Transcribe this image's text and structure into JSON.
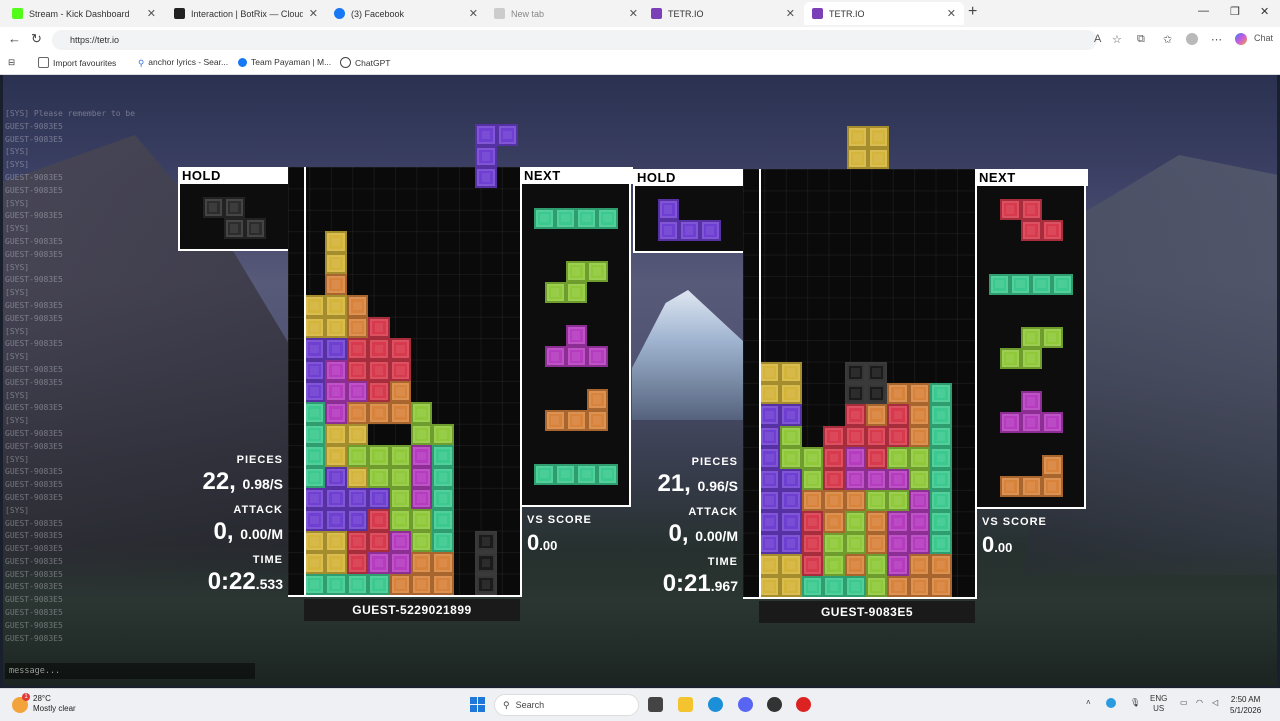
{
  "browser": {
    "tabs": [
      {
        "label": "Stream - Kick Dashboard",
        "fav_color": "#53fc18",
        "active": false
      },
      {
        "label": "Interaction | BotRix — Cloud Stream",
        "fav_color": "#222222",
        "active": false
      },
      {
        "label": "(3) Facebook",
        "fav_color": "#1877f2",
        "active": false
      },
      {
        "label": "New tab",
        "fav_color": "#bbbbbb",
        "active": false
      },
      {
        "label": "TETR.IO",
        "fav_color": "#7b3fb8",
        "active": false
      },
      {
        "label": "TETR.IO",
        "fav_color": "#7b3fb8",
        "active": true
      }
    ],
    "new_tab_label": "+",
    "url": "https://tetr.io",
    "bookmarks": [
      "Import favourites",
      "anchor lyrics - Sear...",
      "Team Payaman | M...",
      "ChatGPT"
    ],
    "copilot_label": "Chat"
  },
  "chat": {
    "lines": [
      "[SYS] Please remember to be",
      "GUEST-9083E5",
      "GUEST-9083E5",
      "[SYS]",
      "[SYS]",
      "GUEST-9083E5",
      "GUEST-9083E5",
      "[SYS]",
      "GUEST-9083E5",
      "[SYS]",
      "GUEST-9083E5",
      "GUEST-9083E5",
      "[SYS]",
      "GUEST-9083E5",
      "[SYS]",
      "GUEST-9083E5",
      "GUEST-9083E5",
      "[SYS]",
      "GUEST-9083E5",
      "[SYS]",
      "GUEST-9083E5",
      "GUEST-9083E5",
      "[SYS]",
      "GUEST-9083E5",
      "[SYS]",
      "GUEST-9083E5",
      "GUEST-9083E5",
      "[SYS]",
      "GUEST-9083E5",
      "GUEST-9083E5",
      "GUEST-9083E5",
      "[SYS]",
      "GUEST-9083E5",
      "GUEST-9083E5",
      "GUEST-9083E5",
      "GUEST-9083E5",
      "GUEST-9083E5",
      "GUEST-9083E5",
      "GUEST-9083E5",
      "GUEST-9083E5",
      "GUEST-9083E5",
      "GUEST-9083E5"
    ],
    "input_placeholder": "message..."
  },
  "colors": {
    "Z": "#d7394d",
    "S": "#8fc93a",
    "L": "#d8833c",
    "J": "#6f3fd1",
    "T": "#b53cbf",
    "I": "#3cc98f",
    "O": "#d4b43a",
    "G": "#6a6a6a",
    "X": "#2a2a2a"
  },
  "players": [
    {
      "hold_title": "HOLD",
      "next_title": "NEXT",
      "hold_piece": "O",
      "hold_greyed": true,
      "next_queue": [
        "I",
        "S",
        "T",
        "L",
        "I"
      ],
      "falling": {
        "type": "J",
        "cells": [
          [
            8,
            -2
          ],
          [
            9,
            -2
          ],
          [
            8,
            -1
          ],
          [
            8,
            0
          ]
        ]
      },
      "board": [
        "..........",
        "..........",
        "..........",
        ".O........",
        ".O........",
        ".L........",
        "OOL.......",
        "OOLZ......",
        "JJZZZ.....",
        "JTZZZ.....",
        "JTTZL.....",
        "ITLLLS....",
        "IOO..SS...",
        "IOSSSTI...",
        "IJOSSTI...",
        "JJJJSTI...",
        "JJJZSSI...",
        "OOZZTSI.X.",
        "OOZTTLL.X.",
        "IIIILLL.X."
      ],
      "pieces_label": "PIECES",
      "pieces": "22",
      "pieces_rate": "0.98/S",
      "attack_label": "ATTACK",
      "attack": "0",
      "attack_rate": "0.00/M",
      "time_label": "TIME",
      "time": "0:22",
      "time_ms": ".533",
      "vs_label": "VS SCORE",
      "vs_score": "0",
      "vs_score_dec": ".00",
      "name": "GUEST-5229021899"
    },
    {
      "hold_title": "HOLD",
      "next_title": "NEXT",
      "hold_piece": "J",
      "hold_greyed": false,
      "next_queue": [
        "Z",
        "I",
        "S",
        "T",
        "L"
      ],
      "falling": {
        "type": "O",
        "cells": [
          [
            4,
            -2
          ],
          [
            5,
            -2
          ],
          [
            4,
            -1
          ],
          [
            5,
            -1
          ]
        ]
      },
      "board": [
        "..........",
        "..........",
        "..........",
        "..........",
        "..........",
        "..........",
        "..........",
        "..........",
        "..........",
        "OO..XX....",
        "OO..XXLLI.",
        "JJ..ZLZLI.",
        "JS.ZZZZLI.",
        "JSSZTZSSI.",
        "JJSZTTTSI.",
        "JJLLLSSTI.",
        "JJZLSLTTI.",
        "JJZSSLTTI.",
        "OOZSLSTLL.",
        "OOIIISLLL."
      ],
      "pieces_label": "PIECES",
      "pieces": "21",
      "pieces_rate": "0.96/S",
      "attack_label": "ATTACK",
      "attack": "0",
      "attack_rate": "0.00/M",
      "time_label": "TIME",
      "time": "0:21",
      "time_ms": ".967",
      "vs_label": "VS SCORE",
      "vs_score": "0",
      "vs_score_dec": ".00",
      "name": "GUEST-9083E5"
    }
  ],
  "taskbar": {
    "temperature": "28°C",
    "weather": "Mostly clear",
    "notification_count": "1",
    "search_label": "Search",
    "lang_top": "ENG",
    "lang_bottom": "US",
    "time": "2:50 AM",
    "date": "5/1/2026"
  }
}
